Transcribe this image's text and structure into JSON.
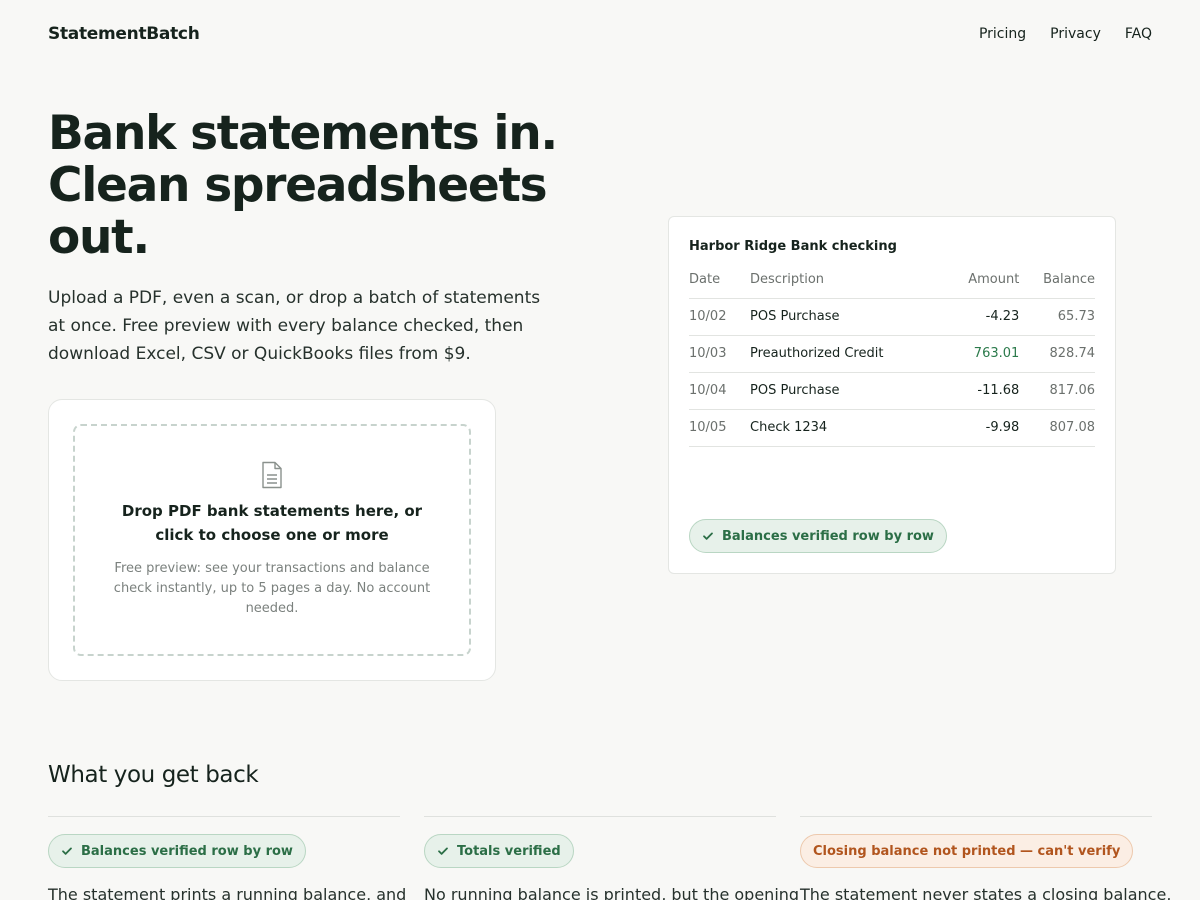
{
  "nav": {
    "brand": "StatementBatch",
    "links": [
      "Pricing",
      "Privacy",
      "FAQ"
    ]
  },
  "hero": {
    "title_lines": [
      "Bank statements in.",
      "Clean spreadsheets",
      "out."
    ],
    "subtitle": "Upload a PDF, even a scan, or drop a batch of statements at once. Free preview with every balance checked, then download Excel, CSV or QuickBooks files from $9."
  },
  "upload": {
    "icon": "file-text-icon",
    "title": "Drop PDF bank statements here, or click to choose one or more",
    "note": "Free preview: see your transactions and balance check instantly, up to 5 pages a day. No account needed."
  },
  "preview": {
    "title": "Harbor Ridge Bank checking",
    "columns": [
      "Date",
      "Description",
      "Amount",
      "Balance"
    ],
    "rows": [
      {
        "date": "10/02",
        "description": "POS Purchase",
        "amount": "-4.23",
        "balance": "65.73",
        "positive": false
      },
      {
        "date": "10/03",
        "description": "Preauthorized Credit",
        "amount": "763.01",
        "balance": "828.74",
        "positive": true
      },
      {
        "date": "10/04",
        "description": "POS Purchase",
        "amount": "-11.68",
        "balance": "817.06",
        "positive": false
      },
      {
        "date": "10/05",
        "description": "Check 1234",
        "amount": "-9.98",
        "balance": "807.08",
        "positive": false
      }
    ],
    "badge": "Balances verified row by row"
  },
  "section": {
    "title": "What you get back",
    "features": [
      {
        "badge": "Balances verified row by row",
        "status": "verified",
        "text": "The statement prints a running balance, and"
      },
      {
        "badge": "Totals verified",
        "status": "verified",
        "text": "No running balance is printed, but the opening"
      },
      {
        "badge": "Closing balance not printed — can't verify",
        "status": "warning",
        "text": "The statement never states a closing balance,"
      }
    ]
  },
  "colors": {
    "background": "#f8f8f6",
    "text": "#16231d",
    "positive_amount": "#2b7a4b",
    "verified_badge_bg": "#e7f1ea",
    "warning_badge_bg": "#fbeee4",
    "warning_text": "#b1551e"
  }
}
